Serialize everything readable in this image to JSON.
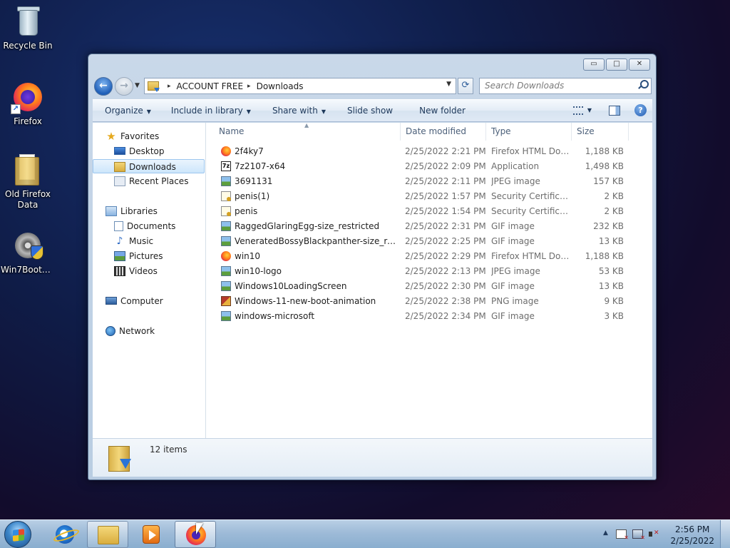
{
  "desktop": {
    "icons": [
      {
        "label": "Recycle Bin",
        "icon": "recycle-bin-icon"
      },
      {
        "label": "Firefox",
        "icon": "firefox-icon"
      },
      {
        "label": "Old Firefox Data",
        "icon": "folder-icon"
      },
      {
        "label": "Win7BootU...",
        "icon": "installer-disc-icon"
      }
    ]
  },
  "window": {
    "controls": {
      "minimize": "▭",
      "maximize": "□",
      "close": "✕"
    },
    "address": {
      "sep": "▸",
      "crumbs": [
        "ACCOUNT FREE",
        "Downloads"
      ]
    },
    "search": {
      "placeholder": "Search Downloads"
    },
    "toolbar": {
      "organize": "Organize",
      "include_in_library": "Include in library",
      "share_with": "Share with",
      "slide_show": "Slide show",
      "new_folder": "New folder"
    },
    "nav": {
      "favorites": "Favorites",
      "desktop": "Desktop",
      "downloads": "Downloads",
      "recent_places": "Recent Places",
      "libraries": "Libraries",
      "documents": "Documents",
      "music": "Music",
      "pictures": "Pictures",
      "videos": "Videos",
      "computer": "Computer",
      "network": "Network"
    },
    "columns": {
      "name": "Name",
      "date_modified": "Date modified",
      "type": "Type",
      "size": "Size"
    },
    "files": [
      {
        "name": "2f4ky7",
        "date": "2/25/2022 2:21 PM",
        "type": "Firefox HTML Doc...",
        "size": "1,188 KB",
        "icon": "firefox-html-icon"
      },
      {
        "name": "7z2107-x64",
        "date": "2/25/2022 2:09 PM",
        "type": "Application",
        "size": "1,498 KB",
        "icon": "7zip-app-icon"
      },
      {
        "name": "3691131",
        "date": "2/25/2022 2:11 PM",
        "type": "JPEG image",
        "size": "157 KB",
        "icon": "image-icon"
      },
      {
        "name": "penis(1)",
        "date": "2/25/2022 1:57 PM",
        "type": "Security Certificate",
        "size": "2 KB",
        "icon": "certificate-icon"
      },
      {
        "name": "penis",
        "date": "2/25/2022 1:54 PM",
        "type": "Security Certificate",
        "size": "2 KB",
        "icon": "certificate-icon"
      },
      {
        "name": "RaggedGlaringEgg-size_restricted",
        "date": "2/25/2022 2:31 PM",
        "type": "GIF image",
        "size": "232 KB",
        "icon": "image-icon"
      },
      {
        "name": "VeneratedBossyBlackpanther-size_restrict...",
        "date": "2/25/2022 2:25 PM",
        "type": "GIF image",
        "size": "13 KB",
        "icon": "image-icon"
      },
      {
        "name": "win10",
        "date": "2/25/2022 2:29 PM",
        "type": "Firefox HTML Doc...",
        "size": "1,188 KB",
        "icon": "firefox-html-icon"
      },
      {
        "name": "win10-logo",
        "date": "2/25/2022 2:13 PM",
        "type": "JPEG image",
        "size": "53 KB",
        "icon": "image-icon"
      },
      {
        "name": "Windows10LoadingScreen",
        "date": "2/25/2022 2:30 PM",
        "type": "GIF image",
        "size": "13 KB",
        "icon": "image-icon"
      },
      {
        "name": "Windows-11-new-boot-animation",
        "date": "2/25/2022 2:38 PM",
        "type": "PNG image",
        "size": "9 KB",
        "icon": "png-image-icon"
      },
      {
        "name": "windows-microsoft",
        "date": "2/25/2022 2:34 PM",
        "type": "GIF image",
        "size": "3 KB",
        "icon": "image-icon"
      }
    ],
    "details": {
      "count": "12 items"
    }
  },
  "taskbar": {
    "clock": {
      "time": "2:56 PM",
      "date": "2/25/2022"
    },
    "tray_expand": "▲"
  }
}
